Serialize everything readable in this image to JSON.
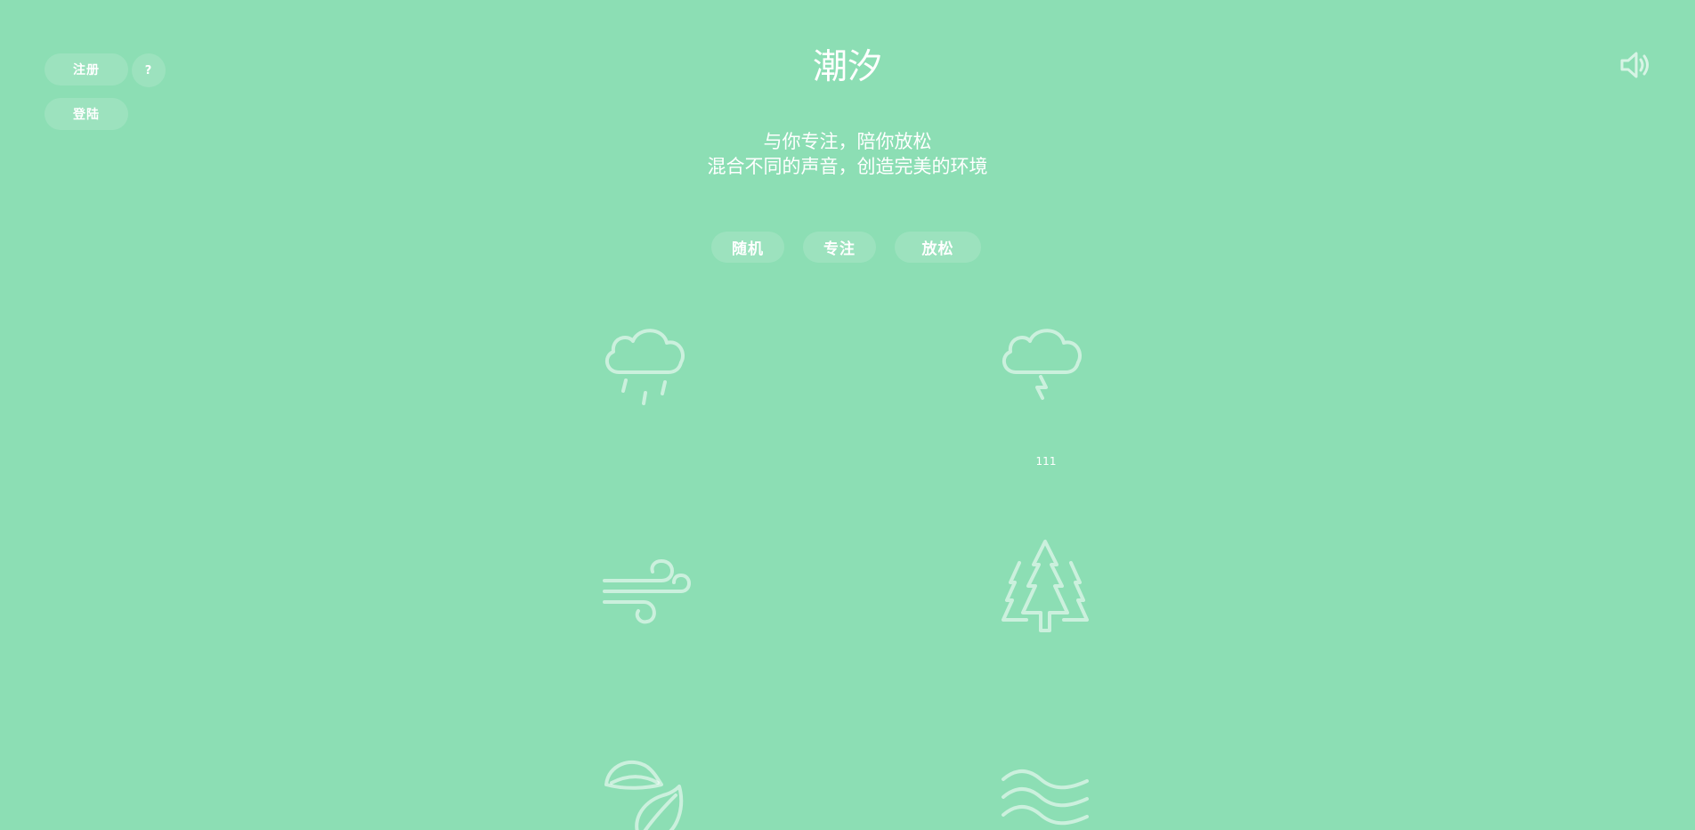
{
  "auth": {
    "register_label": "注册",
    "help_label": "?",
    "login_label": "登陆"
  },
  "header": {
    "title": "潮汐",
    "subtitle_line1": "与你专注，陪你放松",
    "subtitle_line2": "混合不同的声音，创造完美的环境"
  },
  "modes": {
    "random_label": "随机",
    "focus_label": "专注",
    "relax_label": "放松"
  },
  "sounds": [
    {
      "icon": "rain-cloud-icon"
    },
    {
      "icon": "thunder-cloud-icon",
      "volume_label": "111"
    },
    {
      "icon": "wind-icon"
    },
    {
      "icon": "forest-icon"
    },
    {
      "icon": "leaves-icon"
    },
    {
      "icon": "waves-icon"
    }
  ],
  "controls": {
    "volume_icon": "speaker-volume-icon"
  },
  "colors": {
    "background": "#8cdeb4",
    "text": "#ffffff"
  }
}
